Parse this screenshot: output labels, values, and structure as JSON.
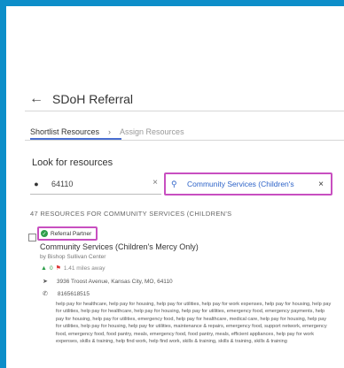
{
  "header": {
    "title": "SDoH Referral"
  },
  "tabs": {
    "active": "Shortlist Resources",
    "separator": "›",
    "inactive": "Assign Resources"
  },
  "search": {
    "label": "Look for resources",
    "zip_value": "64110",
    "query_value": "Community Services (Children's",
    "clear_glyph": "×"
  },
  "results": {
    "count_text": "47 RESOURCES FOR COMMUNITY SERVICES (CHILDREN'S"
  },
  "resource": {
    "badge": "Referral Partner",
    "name": "Community Services (Children's Mercy Only)",
    "org": "by Bishop Sullivan Center",
    "likes": "0",
    "distance": "1.41 miles away",
    "address": "3936 Troost Avenue, Kansas City, MO, 64110",
    "phone": "8165618515",
    "tags": "help pay for healthcare, help pay for housing, help pay for utilities, help pay for work expenses, help pay for housing, help pay for utilities, help pay for healthcare, help pay for housing, help pay for utilities, emergency food, emergency payments, help pay for housing, help pay for utilities, emergency food, help pay for healthcare, medical care, help pay for housing, help pay for utilities, help pay for housing, help pay for utilities, maintenance & repairs, emergency food, support network, emergency food, emergency food, food pantry, meals, emergency food, food pantry, meals, efficient appliances, help pay for work expenses, skills & training, help find work, help find work, skills & training, skills & training, skills & training"
  },
  "icons": {
    "back": "back-arrow-icon",
    "pin": "location-pin-icon",
    "search": "search-icon",
    "check": "check-circle-icon",
    "thumb": "thumbs-up-icon",
    "flag": "flag-icon",
    "navigate": "navigation-arrow-icon",
    "phone": "phone-icon"
  },
  "colors": {
    "frame": "#0d8ec9",
    "highlight": "#c84fc0",
    "accent": "#2d63c8",
    "success": "#2e9e4b"
  }
}
